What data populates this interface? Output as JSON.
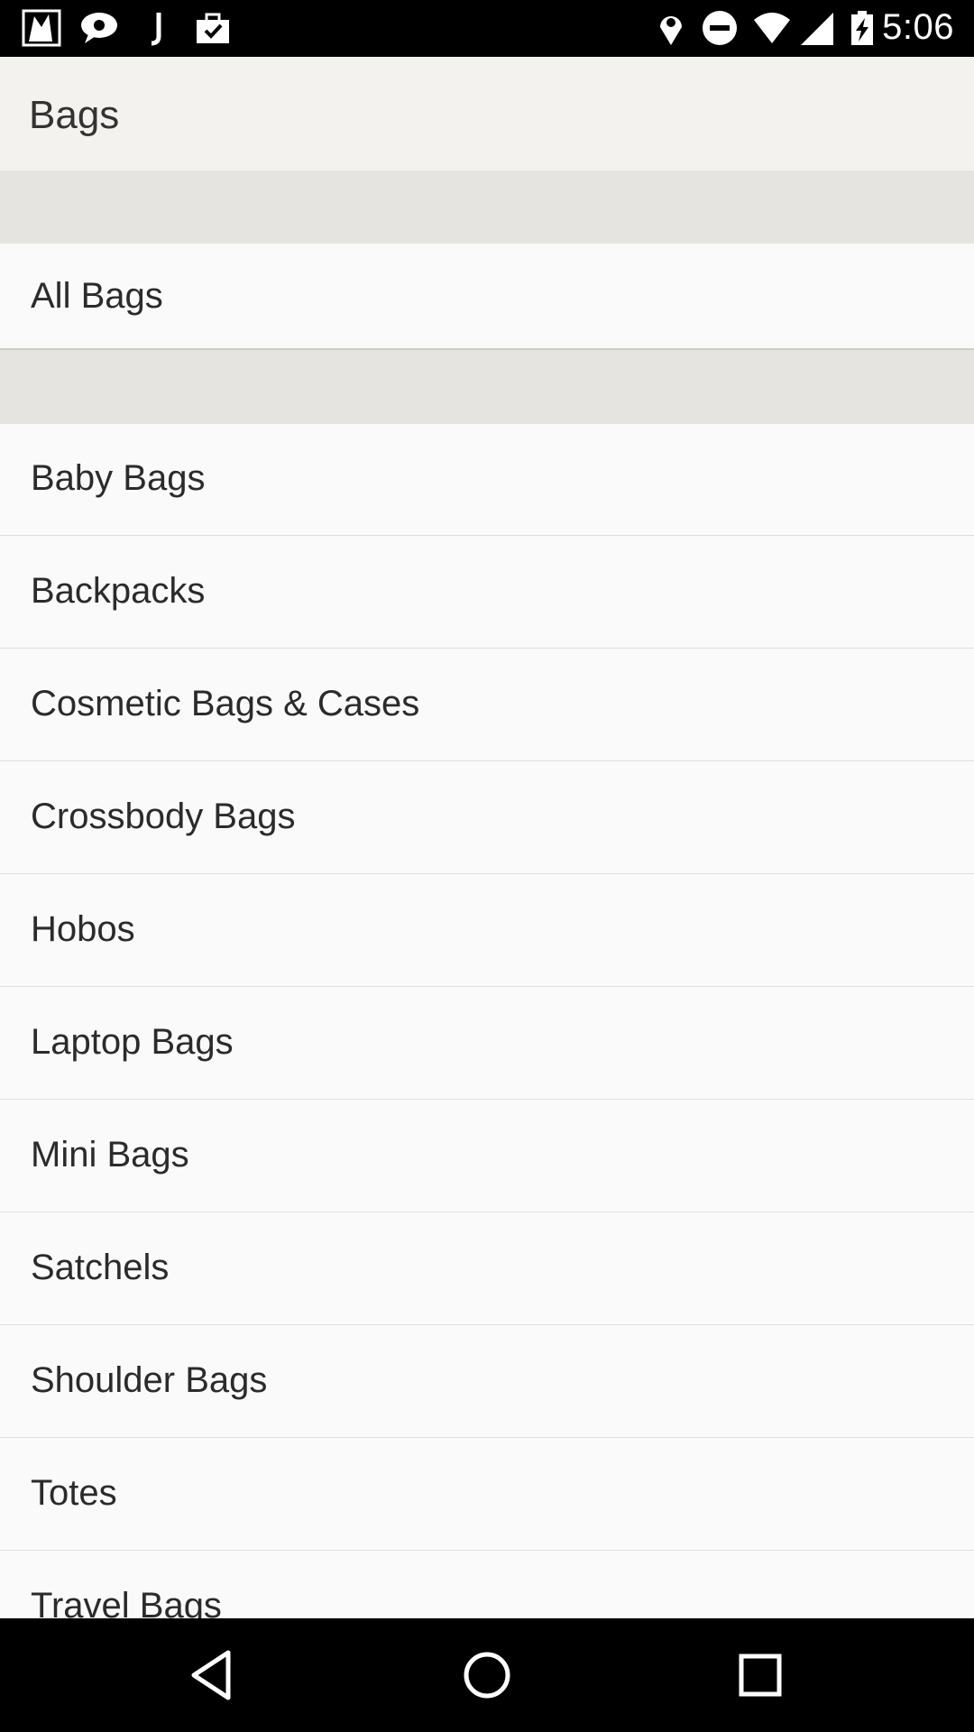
{
  "status_bar": {
    "time": "5:06",
    "left_icons": [
      "image-app-icon",
      "chat-icon",
      "j-app-icon",
      "briefcase-check-icon"
    ],
    "right_icons": [
      "location-icon",
      "do-not-disturb-icon",
      "wifi-icon",
      "signal-icon",
      "battery-charging-icon"
    ]
  },
  "toolbar": {
    "title": "Bags"
  },
  "all_item": {
    "label": "All Bags"
  },
  "categories": [
    {
      "label": "Baby Bags"
    },
    {
      "label": "Backpacks"
    },
    {
      "label": "Cosmetic Bags & Cases"
    },
    {
      "label": "Crossbody Bags"
    },
    {
      "label": "Hobos"
    },
    {
      "label": "Laptop Bags"
    },
    {
      "label": "Mini Bags"
    },
    {
      "label": "Satchels"
    },
    {
      "label": "Shoulder Bags"
    },
    {
      "label": "Totes"
    },
    {
      "label": "Travel Bags"
    }
  ],
  "nav_bar": {
    "buttons": [
      "back-icon",
      "home-icon",
      "recents-icon"
    ]
  },
  "colors": {
    "toolbar_bg": "#f4f2ee",
    "section_gap": "#e6e4e0",
    "list_bg": "#fafafa",
    "text": "#2b2b2b"
  }
}
